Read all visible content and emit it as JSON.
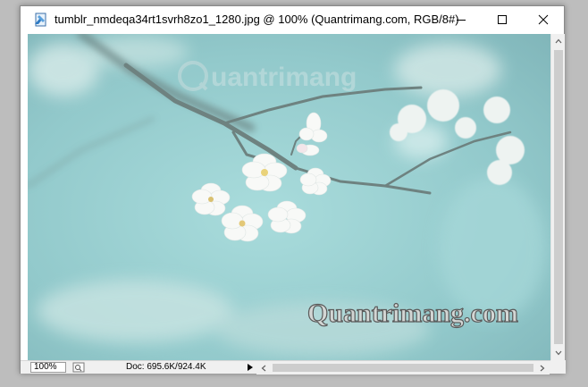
{
  "window": {
    "title": "tumblr_nmdeqa34rt1svrh8zo1_1280.jpg @ 100% (Quantrimang.com, RGB/8#)",
    "minimize_icon": "minimize-icon",
    "maximize_icon": "maximize-icon",
    "close_icon": "close-icon"
  },
  "canvas": {
    "watermark_top": "uantrimang",
    "watermark_bottom": "Quantrimang.com"
  },
  "statusbar": {
    "zoom": "100%",
    "doc_info": "Doc: 695.6K/924.4K"
  },
  "colors": {
    "background_teal": "#9dd0d2",
    "blossom": "#f7f7f5",
    "branch": "#6b7f7e"
  }
}
